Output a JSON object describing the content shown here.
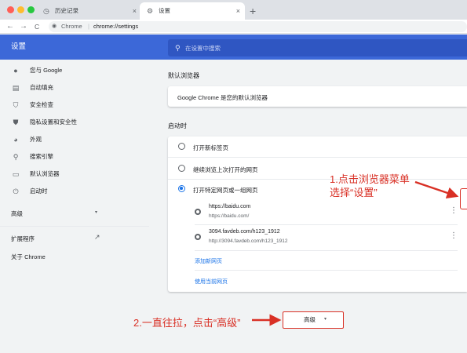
{
  "tabs": [
    {
      "title": "历史记录",
      "icon": "history-icon",
      "close": "×"
    },
    {
      "title": "设置",
      "icon": "gear-icon",
      "close": "×"
    }
  ],
  "new_tab": "+",
  "toolbar": {
    "back": "←",
    "forward": "→",
    "reload": "C",
    "domain": "Chrome",
    "separator": "|",
    "url": "chrome://settings"
  },
  "header": {
    "title": "设置",
    "search_placeholder": "在设置中搜索"
  },
  "sidebar": {
    "items": [
      {
        "label": "您与 Google",
        "icon": "person-icon",
        "glyph": "●"
      },
      {
        "label": "自动填充",
        "icon": "clipboard-icon",
        "glyph": "▤"
      },
      {
        "label": "安全检查",
        "icon": "shield-check-icon",
        "glyph": "⛉"
      },
      {
        "label": "隐私设置和安全性",
        "icon": "shield-icon",
        "glyph": "⛊"
      },
      {
        "label": "外观",
        "icon": "palette-icon",
        "glyph": "◕"
      },
      {
        "label": "搜索引擎",
        "icon": "search-icon",
        "glyph": "⚲"
      },
      {
        "label": "默认浏览器",
        "icon": "browser-icon",
        "glyph": "▭"
      },
      {
        "label": "启动时",
        "icon": "power-icon",
        "glyph": "⏻"
      }
    ],
    "advanced": "高级",
    "advanced_caret": "▾",
    "extensions": "扩展程序",
    "extensions_icon": "↗",
    "about": "关于 Chrome"
  },
  "default_browser": {
    "section_title": "默认浏览器",
    "text": "Google Chrome 是您的默认浏览器"
  },
  "startup": {
    "section_title": "启动时",
    "options": [
      {
        "label": "打开新标签页",
        "checked": false
      },
      {
        "label": "继续浏览上次打开的网页",
        "checked": false
      },
      {
        "label": "打开特定网页或一组网页",
        "checked": true
      }
    ],
    "pages": [
      {
        "name": "https://baidu.com",
        "url": "https://baidu.com/"
      },
      {
        "name": "3094.favdeb.com/h123_1912",
        "url": "http://3094.favdeb.com/h123_1912"
      }
    ],
    "more_glyph": "⋮",
    "add_page": "添加新网页",
    "use_current": "使用当前网页"
  },
  "advanced_button": {
    "label": "高级",
    "caret": "▾"
  },
  "annotations": {
    "step1_line1": "1.点击浏览器菜单",
    "step1_line2": "选择“设置”",
    "step2": "2.一直往拉，点击“高级”",
    "color": "#d93025"
  },
  "colors": {
    "header": "#3c68d8",
    "accent": "#1a73e8",
    "annotation": "#d93025"
  }
}
